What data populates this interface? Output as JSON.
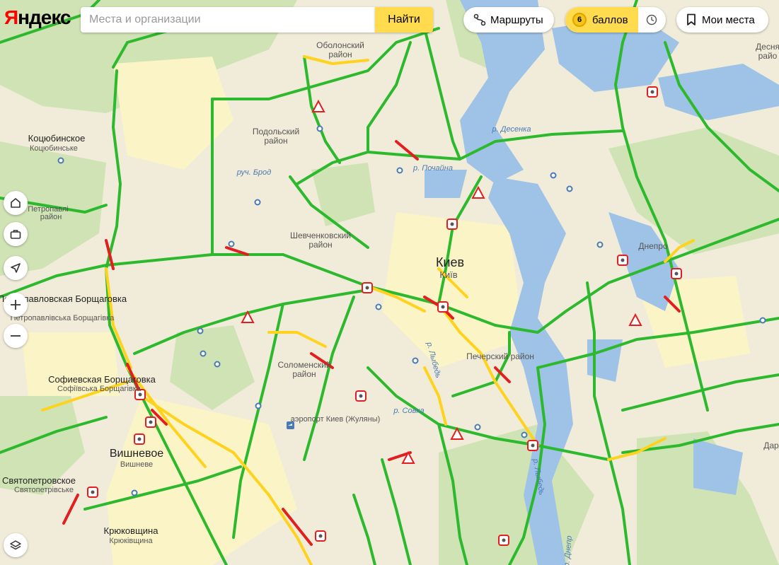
{
  "logo": {
    "text_first": "Я",
    "text_rest": "ндекс"
  },
  "search": {
    "placeholder": "Места и организации",
    "button_label": "Найти"
  },
  "routes": {
    "label": "Маршруты"
  },
  "points": {
    "count": "6",
    "label": "баллов"
  },
  "my_places": {
    "label": "Мои места"
  },
  "controls": [
    "home-icon",
    "briefcase-icon",
    "locate-icon",
    "zoom-in-icon",
    "zoom-out-icon",
    "layers-icon"
  ],
  "colors": {
    "accent": "#ffdb4d",
    "traffic_free": "#2db92d",
    "traffic_slow": "#ffd21e",
    "traffic_jam": "#e31e1e"
  },
  "map": {
    "city_main": "Киев",
    "city_main_ua": "Київ",
    "labels": [
      {
        "id": "obolon",
        "lines": [
          "Оболонский",
          "район"
        ]
      },
      {
        "id": "podil",
        "lines": [
          "Подольский",
          "район"
        ]
      },
      {
        "id": "shevchenko",
        "lines": [
          "Шевченковский",
          "район"
        ]
      },
      {
        "id": "solomyansky",
        "lines": [
          "Соломенский",
          "район"
        ]
      },
      {
        "id": "pechersk",
        "lines": [
          "Печерский район"
        ]
      },
      {
        "id": "dnipro",
        "lines": [
          "Днепро"
        ]
      },
      {
        "id": "desna",
        "lines": [
          "Десня",
          "райо"
        ]
      },
      {
        "id": "dar",
        "lines": [
          "Дар"
        ]
      }
    ],
    "towns": [
      {
        "id": "kotsubinske",
        "ru": "Коцюбинское",
        "ua": "Коцюбинське"
      },
      {
        "id": "borschagivka",
        "ru": "Петропавловская Борщаговка",
        "ua": "Петропавлівська Борщагівка"
      },
      {
        "id": "sofborsch",
        "ru": "Софиевская Борщаговка",
        "ua": "Софіївська Борщагівка"
      },
      {
        "id": "vyshneve",
        "ru": "Вишневое",
        "ua": "Вишневе"
      },
      {
        "id": "svyatopetr",
        "ru": "Святопетровское",
        "ua": "Святопетрівське"
      },
      {
        "id": "kryukovshchina",
        "ru": "Крюковщина",
        "ua": "Крюківщина"
      },
      {
        "id": "west_edge",
        "ru": "Петропавлі",
        "ua": "район"
      }
    ],
    "water": [
      {
        "id": "desenka",
        "text": "р. Десенка"
      },
      {
        "id": "pochaina",
        "text": "р. Почайна"
      },
      {
        "id": "brod",
        "text": "руч. Брод"
      },
      {
        "id": "sovka",
        "text": "р. Совка"
      },
      {
        "id": "lybid",
        "text": "р. Лыбедь"
      },
      {
        "id": "lybid2",
        "text": "р. Лыбедь"
      },
      {
        "id": "dnipro_river",
        "text": "р. Днепр"
      }
    ],
    "airport": "аэропорт Киев (Жуляны)"
  }
}
